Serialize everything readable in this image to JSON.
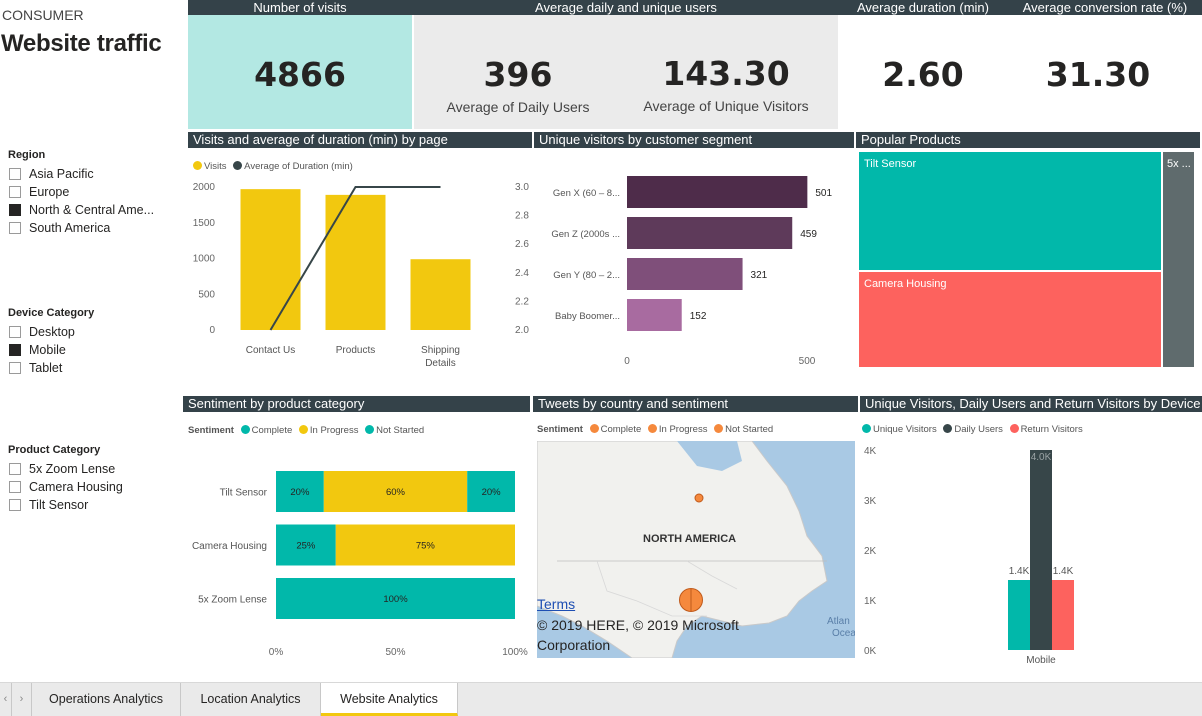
{
  "report": {
    "kicker": "CONSUMER",
    "title": "Website traffic"
  },
  "kpis": {
    "visits": {
      "header": "Number of visits",
      "value": "4866"
    },
    "users": {
      "header": "Average daily and unique users",
      "daily_value": "396",
      "daily_label": "Average of Daily Users",
      "unique_value": "143.30",
      "unique_label": "Average of Unique Visitors"
    },
    "duration": {
      "header": "Average duration (min)",
      "value": "2.60"
    },
    "conversion": {
      "header": "Average  conversion rate (%)",
      "value": "31.30"
    }
  },
  "slicers": {
    "region": {
      "title": "Region",
      "items": [
        {
          "label": "Asia Pacific",
          "checked": false
        },
        {
          "label": "Europe",
          "checked": false
        },
        {
          "label": "North & Central Ame...",
          "checked": true
        },
        {
          "label": "South America",
          "checked": false
        }
      ]
    },
    "device": {
      "title": "Device Category",
      "items": [
        {
          "label": "Desktop",
          "checked": false
        },
        {
          "label": "Mobile",
          "checked": true
        },
        {
          "label": "Tablet",
          "checked": false
        }
      ]
    },
    "product": {
      "title": "Product Category",
      "items": [
        {
          "label": "5x Zoom Lense",
          "checked": false
        },
        {
          "label": "Camera Housing",
          "checked": false
        },
        {
          "label": "Tilt Sensor",
          "checked": false
        }
      ]
    }
  },
  "colors": {
    "header_bg": "#344249",
    "kpi_teal": "#b3e8e3",
    "kpi_grey": "#ebebeb",
    "yellow": "#f2c80f",
    "teal": "#01b8aa",
    "dark": "#374649",
    "red": "#fd625e",
    "orange": "#f5893d",
    "map_bg": "#a9c9e4"
  },
  "chart_data": [
    {
      "id": "visits_duration",
      "header": "Visits and average of duration (min) by page",
      "type": "bar",
      "categories": [
        "Contact Us",
        "Products",
        "Shipping Details"
      ],
      "category_lines": [
        [
          "Contact Us"
        ],
        [
          "Products"
        ],
        [
          "Shipping",
          "Details"
        ]
      ],
      "series": [
        {
          "name": "Visits",
          "values": [
            1970,
            1890,
            990
          ],
          "axis": "left",
          "kind": "bar",
          "color": "#f2c80f"
        },
        {
          "name": "Average of Duration (min)",
          "values": [
            2.0,
            3.0,
            3.0
          ],
          "axis": "right",
          "kind": "line",
          "color": "#374649"
        }
      ],
      "ylim": [
        0,
        2000
      ],
      "y_ticks": [
        0,
        500,
        1000,
        1500,
        2000
      ],
      "y2lim": [
        2.0,
        3.0
      ],
      "y2_ticks": [
        "2.0",
        "2.2",
        "2.4",
        "2.6",
        "2.8",
        "3.0"
      ]
    },
    {
      "id": "segment",
      "header": "Unique visitors by customer segment",
      "type": "bar",
      "orientation": "horizontal",
      "categories": [
        "Gen X (60 – 8...",
        "Gen Z (2000s ...",
        "Gen Y (80 – 2...",
        "Baby Boomer..."
      ],
      "values": [
        501,
        459,
        321,
        152
      ],
      "colors": [
        "#4e2c4a",
        "#5e3a5a",
        "#7f4f7a",
        "#a86ba0"
      ],
      "xlim": [
        0,
        500
      ],
      "x_ticks": [
        0,
        500
      ]
    },
    {
      "id": "popular_products",
      "header": "Popular Products",
      "type": "treemap",
      "items": [
        {
          "label": "Tilt Sensor",
          "color": "#01b8aa"
        },
        {
          "label": "Camera Housing",
          "color": "#fd625e"
        },
        {
          "label": "5x ...",
          "color": "#5f6b6d"
        }
      ]
    },
    {
      "id": "sentiment",
      "header": "Sentiment by product category",
      "type": "bar",
      "orientation": "horizontal",
      "stacked": "100%",
      "legend_title": "Sentiment",
      "categories": [
        "Tilt Sensor",
        "Camera Housing",
        "5x Zoom Lense"
      ],
      "series": [
        {
          "name": "Complete",
          "values": [
            20,
            25,
            100
          ],
          "color": "#01b8aa"
        },
        {
          "name": "In Progress",
          "values": [
            60,
            75,
            0
          ],
          "color": "#f2c80f"
        },
        {
          "name": "Not Started",
          "values": [
            20,
            0,
            0
          ],
          "color": "#01b8aa"
        }
      ],
      "x_ticks": [
        "0%",
        "50%",
        "100%"
      ]
    },
    {
      "id": "device_visitors",
      "header": "Unique Visitors, Daily Users and Return Visitors by Device ...",
      "type": "bar",
      "categories": [
        "Mobile"
      ],
      "series": [
        {
          "name": "Unique Visitors",
          "values": [
            1400
          ],
          "label": "1.4K",
          "color": "#01b8aa"
        },
        {
          "name": "Daily Users",
          "values": [
            4000
          ],
          "label": "4.0K",
          "color": "#374649"
        },
        {
          "name": "Return Visitors",
          "values": [
            1400
          ],
          "label": "1.4K",
          "color": "#fd625e"
        }
      ],
      "ylim": [
        0,
        4000
      ],
      "y_ticks": [
        "0K",
        "1K",
        "2K",
        "3K",
        "4K"
      ]
    }
  ],
  "map": {
    "header": "Tweets by country and sentiment",
    "legend_title": "Sentiment",
    "legend": [
      "Complete",
      "In Progress",
      "Not Started"
    ],
    "region_label": "NORTH AMERICA",
    "ocean_label_1": "Atlan",
    "ocean_label_2": "Ocea",
    "terms_link": "Terms",
    "copyright": "© 2019 HERE, © 2019 Microsoft Corporation"
  },
  "tabs": [
    {
      "label": "Operations Analytics",
      "active": false
    },
    {
      "label": "Location Analytics",
      "active": false
    },
    {
      "label": "Website Analytics",
      "active": true
    }
  ]
}
